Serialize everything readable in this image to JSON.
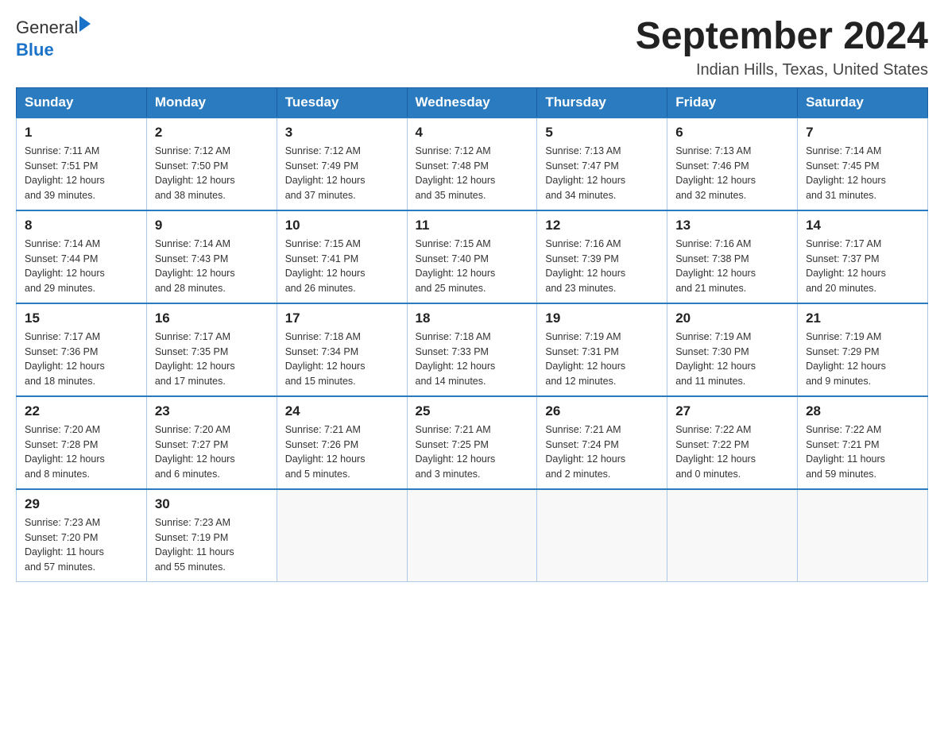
{
  "logo": {
    "text_general": "General",
    "text_blue": "Blue",
    "arrow_alt": "logo arrow"
  },
  "title": "September 2024",
  "subtitle": "Indian Hills, Texas, United States",
  "days_of_week": [
    "Sunday",
    "Monday",
    "Tuesday",
    "Wednesday",
    "Thursday",
    "Friday",
    "Saturday"
  ],
  "weeks": [
    [
      {
        "day": "1",
        "sunrise": "7:11 AM",
        "sunset": "7:51 PM",
        "daylight": "12 hours and 39 minutes."
      },
      {
        "day": "2",
        "sunrise": "7:12 AM",
        "sunset": "7:50 PM",
        "daylight": "12 hours and 38 minutes."
      },
      {
        "day": "3",
        "sunrise": "7:12 AM",
        "sunset": "7:49 PM",
        "daylight": "12 hours and 37 minutes."
      },
      {
        "day": "4",
        "sunrise": "7:12 AM",
        "sunset": "7:48 PM",
        "daylight": "12 hours and 35 minutes."
      },
      {
        "day": "5",
        "sunrise": "7:13 AM",
        "sunset": "7:47 PM",
        "daylight": "12 hours and 34 minutes."
      },
      {
        "day": "6",
        "sunrise": "7:13 AM",
        "sunset": "7:46 PM",
        "daylight": "12 hours and 32 minutes."
      },
      {
        "day": "7",
        "sunrise": "7:14 AM",
        "sunset": "7:45 PM",
        "daylight": "12 hours and 31 minutes."
      }
    ],
    [
      {
        "day": "8",
        "sunrise": "7:14 AM",
        "sunset": "7:44 PM",
        "daylight": "12 hours and 29 minutes."
      },
      {
        "day": "9",
        "sunrise": "7:14 AM",
        "sunset": "7:43 PM",
        "daylight": "12 hours and 28 minutes."
      },
      {
        "day": "10",
        "sunrise": "7:15 AM",
        "sunset": "7:41 PM",
        "daylight": "12 hours and 26 minutes."
      },
      {
        "day": "11",
        "sunrise": "7:15 AM",
        "sunset": "7:40 PM",
        "daylight": "12 hours and 25 minutes."
      },
      {
        "day": "12",
        "sunrise": "7:16 AM",
        "sunset": "7:39 PM",
        "daylight": "12 hours and 23 minutes."
      },
      {
        "day": "13",
        "sunrise": "7:16 AM",
        "sunset": "7:38 PM",
        "daylight": "12 hours and 21 minutes."
      },
      {
        "day": "14",
        "sunrise": "7:17 AM",
        "sunset": "7:37 PM",
        "daylight": "12 hours and 20 minutes."
      }
    ],
    [
      {
        "day": "15",
        "sunrise": "7:17 AM",
        "sunset": "7:36 PM",
        "daylight": "12 hours and 18 minutes."
      },
      {
        "day": "16",
        "sunrise": "7:17 AM",
        "sunset": "7:35 PM",
        "daylight": "12 hours and 17 minutes."
      },
      {
        "day": "17",
        "sunrise": "7:18 AM",
        "sunset": "7:34 PM",
        "daylight": "12 hours and 15 minutes."
      },
      {
        "day": "18",
        "sunrise": "7:18 AM",
        "sunset": "7:33 PM",
        "daylight": "12 hours and 14 minutes."
      },
      {
        "day": "19",
        "sunrise": "7:19 AM",
        "sunset": "7:31 PM",
        "daylight": "12 hours and 12 minutes."
      },
      {
        "day": "20",
        "sunrise": "7:19 AM",
        "sunset": "7:30 PM",
        "daylight": "12 hours and 11 minutes."
      },
      {
        "day": "21",
        "sunrise": "7:19 AM",
        "sunset": "7:29 PM",
        "daylight": "12 hours and 9 minutes."
      }
    ],
    [
      {
        "day": "22",
        "sunrise": "7:20 AM",
        "sunset": "7:28 PM",
        "daylight": "12 hours and 8 minutes."
      },
      {
        "day": "23",
        "sunrise": "7:20 AM",
        "sunset": "7:27 PM",
        "daylight": "12 hours and 6 minutes."
      },
      {
        "day": "24",
        "sunrise": "7:21 AM",
        "sunset": "7:26 PM",
        "daylight": "12 hours and 5 minutes."
      },
      {
        "day": "25",
        "sunrise": "7:21 AM",
        "sunset": "7:25 PM",
        "daylight": "12 hours and 3 minutes."
      },
      {
        "day": "26",
        "sunrise": "7:21 AM",
        "sunset": "7:24 PM",
        "daylight": "12 hours and 2 minutes."
      },
      {
        "day": "27",
        "sunrise": "7:22 AM",
        "sunset": "7:22 PM",
        "daylight": "12 hours and 0 minutes."
      },
      {
        "day": "28",
        "sunrise": "7:22 AM",
        "sunset": "7:21 PM",
        "daylight": "11 hours and 59 minutes."
      }
    ],
    [
      {
        "day": "29",
        "sunrise": "7:23 AM",
        "sunset": "7:20 PM",
        "daylight": "11 hours and 57 minutes."
      },
      {
        "day": "30",
        "sunrise": "7:23 AM",
        "sunset": "7:19 PM",
        "daylight": "11 hours and 55 minutes."
      },
      null,
      null,
      null,
      null,
      null
    ]
  ],
  "labels": {
    "sunrise": "Sunrise:",
    "sunset": "Sunset:",
    "daylight": "Daylight:"
  }
}
